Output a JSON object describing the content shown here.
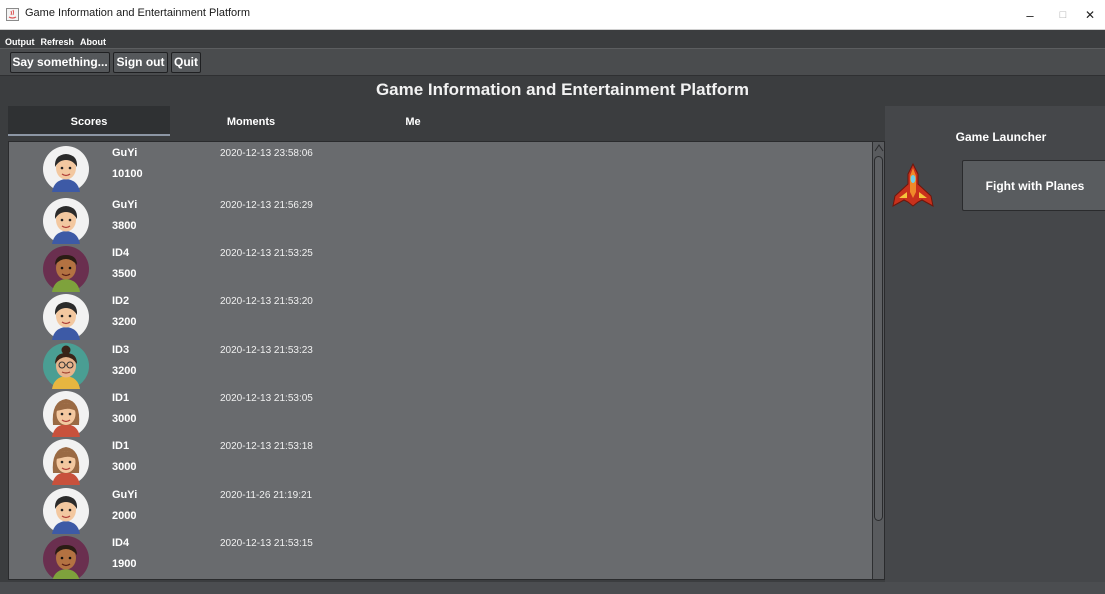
{
  "window": {
    "title": "Game Information and Entertainment Platform",
    "minimize_glyph": "–",
    "maximize_glyph": "□",
    "close_glyph": "✕"
  },
  "menu": [
    "Output",
    "Refresh",
    "About"
  ],
  "toolbar": {
    "say_label": "Say something...",
    "signout_label": "Sign out",
    "quit_label": "Quit"
  },
  "heading": "Game Information and Entertainment Platform",
  "tabs": [
    "Scores",
    "Moments",
    "Me"
  ],
  "scores": [
    {
      "name": "GuYi",
      "score": "10100",
      "time": "2020-12-13 23:58:06",
      "avatar": "boy"
    },
    {
      "name": "GuYi",
      "score": "3800",
      "time": "2020-12-13 21:56:29",
      "avatar": "boy"
    },
    {
      "name": "ID4",
      "score": "3500",
      "time": "2020-12-13 21:53:25",
      "avatar": "dark-boy"
    },
    {
      "name": "ID2",
      "score": "3200",
      "time": "2020-12-13 21:53:20",
      "avatar": "boy"
    },
    {
      "name": "ID3",
      "score": "3200",
      "time": "2020-12-13 21:53:23",
      "avatar": "glasses-girl"
    },
    {
      "name": "ID1",
      "score": "3000",
      "time": "2020-12-13 21:53:05",
      "avatar": "girl"
    },
    {
      "name": "ID1",
      "score": "3000",
      "time": "2020-12-13 21:53:18",
      "avatar": "girl"
    },
    {
      "name": "GuYi",
      "score": "2000",
      "time": "2020-11-26 21:19:21",
      "avatar": "boy"
    },
    {
      "name": "ID4",
      "score": "1900",
      "time": "2020-12-13 21:53:15",
      "avatar": "dark-boy"
    }
  ],
  "launcher": {
    "title": "Game Launcher",
    "game_label": "Fight with Planes",
    "game_icon": "plane-icon"
  },
  "colors": {
    "background": "#3b3d3f",
    "panel": "#696b6e",
    "right_panel": "#45474a"
  }
}
